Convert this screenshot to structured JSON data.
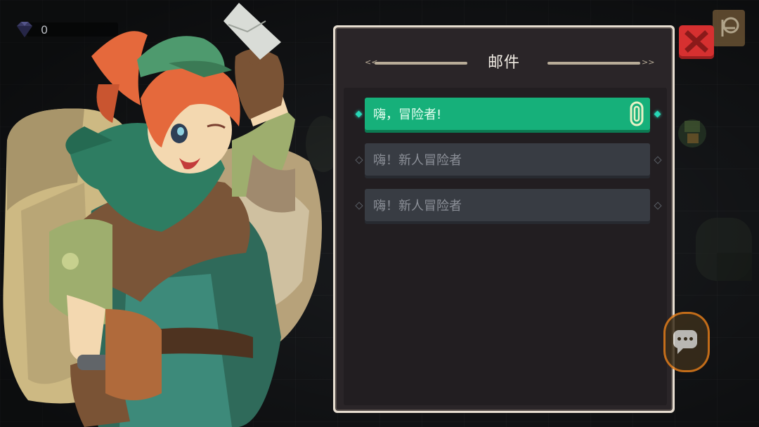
{
  "hud": {
    "gem_icon": "purple-gem-icon",
    "gem_count": "0"
  },
  "mail": {
    "title": "邮件",
    "items": [
      {
        "subject": "嗨，冒险者!",
        "state": "unread",
        "has_attachment": true,
        "attachment_icon": "paperclip-icon"
      },
      {
        "subject": "嗨！新人冒险者",
        "state": "read",
        "has_attachment": false
      },
      {
        "subject": "嗨！新人冒险者",
        "state": "read",
        "has_attachment": false
      }
    ]
  },
  "buttons": {
    "close_icon": "close-x-icon",
    "exit_icon": "exit-door-icon",
    "chat_icon": "chat-bubble-icon"
  },
  "colors": {
    "unread_mail": "#16b07a",
    "read_mail": "#383c43",
    "close_button": "#d63030",
    "panel_border": "#e6ddd0"
  }
}
